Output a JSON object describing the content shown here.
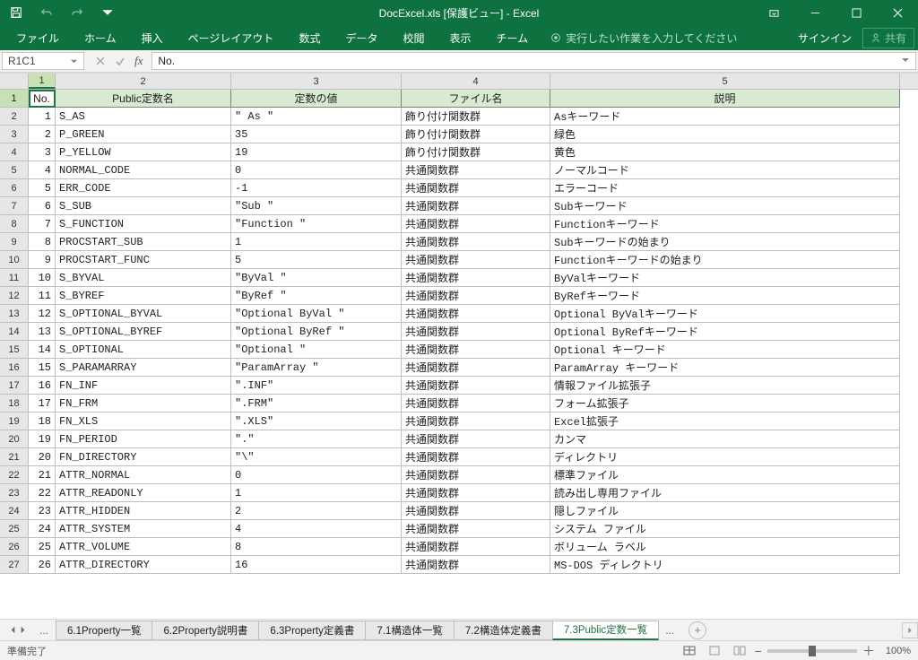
{
  "title": "DocExcel.xls [保護ビュー] - Excel",
  "ribbon": [
    "ファイル",
    "ホーム",
    "挿入",
    "ページレイアウト",
    "数式",
    "データ",
    "校閲",
    "表示",
    "チーム"
  ],
  "tellme": "実行したい作業を入力してください",
  "signin": "サインイン",
  "share": "共有",
  "namebox": "R1C1",
  "formula": "No.",
  "col_headers": [
    "1",
    "2",
    "3",
    "4",
    "5"
  ],
  "header_row": [
    "No.",
    "Public定数名",
    "定数の値",
    "ファイル名",
    "説明"
  ],
  "rows": [
    [
      "1",
      "S_AS",
      "\" As \"",
      "飾り付け関数群",
      "Asキーワード"
    ],
    [
      "2",
      "P_GREEN",
      "35",
      "飾り付け関数群",
      "緑色"
    ],
    [
      "3",
      "P_YELLOW",
      "19",
      "飾り付け関数群",
      "黄色"
    ],
    [
      "4",
      "NORMAL_CODE",
      "0",
      "共通関数群",
      "ノーマルコード"
    ],
    [
      "5",
      "ERR_CODE",
      " -1",
      "共通関数群",
      "エラーコード"
    ],
    [
      "6",
      "S_SUB",
      "\"Sub \"",
      "共通関数群",
      "Subキーワード"
    ],
    [
      "7",
      "S_FUNCTION",
      "\"Function \"",
      "共通関数群",
      "Functionキーワード"
    ],
    [
      "8",
      "PROCSTART_SUB",
      "1",
      "共通関数群",
      "Subキーワードの始まり"
    ],
    [
      "9",
      "PROCSTART_FUNC",
      "5",
      "共通関数群",
      "Functionキーワードの始まり"
    ],
    [
      "10",
      "S_BYVAL",
      "\"ByVal \"",
      "共通関数群",
      "ByValキーワード"
    ],
    [
      "11",
      "S_BYREF",
      "\"ByRef \"",
      "共通関数群",
      "ByRefキーワード"
    ],
    [
      "12",
      "S_OPTIONAL_BYVAL",
      "\"Optional ByVal \"",
      "共通関数群",
      "Optional ByValキーワード"
    ],
    [
      "13",
      "S_OPTIONAL_BYREF",
      "\"Optional ByRef \"",
      "共通関数群",
      "Optional ByRefキーワード"
    ],
    [
      "14",
      "S_OPTIONAL",
      "\"Optional \"",
      "共通関数群",
      "Optional キーワード"
    ],
    [
      "15",
      "S_PARAMARRAY",
      "\"ParamArray \"",
      "共通関数群",
      "ParamArray キーワード"
    ],
    [
      "16",
      "FN_INF",
      "\".INF\"",
      "共通関数群",
      "情報ファイル拡張子"
    ],
    [
      "17",
      "FN_FRM",
      "\".FRM\"",
      "共通関数群",
      "フォーム拡張子"
    ],
    [
      "18",
      "FN_XLS",
      "\".XLS\"",
      "共通関数群",
      "Excel拡張子"
    ],
    [
      "19",
      "FN_PERIOD",
      "\".\"",
      "共通関数群",
      "カンマ"
    ],
    [
      "20",
      "FN_DIRECTORY",
      "\"\\\"",
      "共通関数群",
      "ディレクトリ"
    ],
    [
      "21",
      "ATTR_NORMAL",
      "0",
      "共通関数群",
      "標準ファイル"
    ],
    [
      "22",
      "ATTR_READONLY",
      "1",
      "共通関数群",
      "読み出し専用ファイル"
    ],
    [
      "23",
      "ATTR_HIDDEN",
      "2",
      "共通関数群",
      "隠しファイル"
    ],
    [
      "24",
      "ATTR_SYSTEM",
      "4",
      "共通関数群",
      "システム ファイル"
    ],
    [
      "25",
      "ATTR_VOLUME",
      "8",
      "共通関数群",
      "ボリューム ラベル"
    ],
    [
      "26",
      "ATTR_DIRECTORY",
      "16",
      "共通関数群",
      "MS-DOS ディレクトリ"
    ]
  ],
  "sheets": [
    "6.1Property一覧",
    "6.2Property説明書",
    "6.3Property定義書",
    "7.1構造体一覧",
    "7.2構造体定義書",
    "7.3Public定数一覧"
  ],
  "active_sheet": 5,
  "status": "準備完了",
  "zoom": "100%"
}
